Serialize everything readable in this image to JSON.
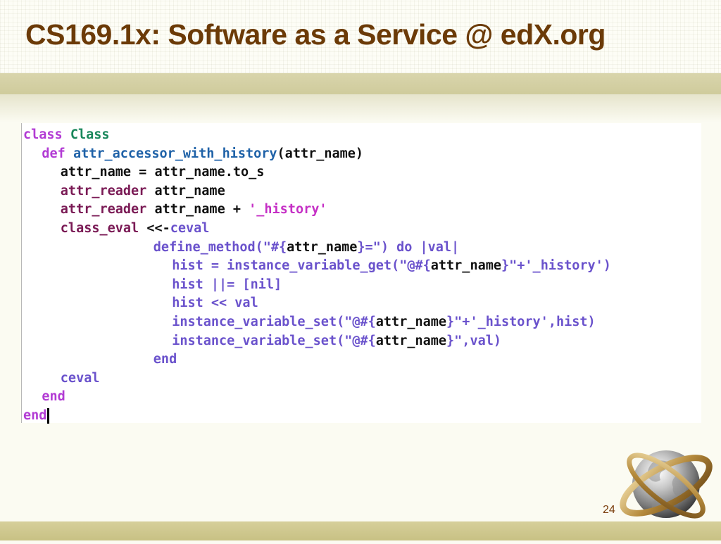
{
  "slide": {
    "title": "CS169.1x: Software as a Service @ edX.org",
    "page_number": "24"
  },
  "code": {
    "lines": [
      {
        "indent": 0,
        "tokens": [
          {
            "t": "class",
            "c": "kw"
          },
          {
            "t": " "
          },
          {
            "t": "Class",
            "c": "cls"
          }
        ]
      },
      {
        "indent": 2,
        "tokens": [
          {
            "t": "def",
            "c": "kw"
          },
          {
            "t": " "
          },
          {
            "t": "attr_accessor_with_history",
            "c": "fn"
          },
          {
            "t": "(attr_name)"
          }
        ]
      },
      {
        "indent": 4,
        "tokens": [
          {
            "t": "attr_name = attr_name.to_s"
          }
        ]
      },
      {
        "indent": 4,
        "tokens": [
          {
            "t": "attr_reader",
            "c": "sym"
          },
          {
            "t": " attr_name"
          }
        ]
      },
      {
        "indent": 4,
        "tokens": [
          {
            "t": "attr_reader",
            "c": "sym"
          },
          {
            "t": " attr_name + "
          },
          {
            "t": "'_history'",
            "c": "str"
          }
        ]
      },
      {
        "indent": 4,
        "tokens": [
          {
            "t": "class_eval",
            "c": "sym"
          },
          {
            "t": " <<-"
          },
          {
            "t": "ceval",
            "c": "heredoc"
          }
        ]
      },
      {
        "indent": 14,
        "tokens": [
          {
            "t": "define_method(\"#{",
            "c": "heredoc"
          },
          {
            "t": "attr_name",
            "c": "interp"
          },
          {
            "t": "}=\") do |val|",
            "c": "heredoc"
          }
        ]
      },
      {
        "indent": 16,
        "tokens": [
          {
            "t": "hist = instance_variable_get(\"@#{",
            "c": "heredoc"
          },
          {
            "t": "attr_name",
            "c": "interp"
          },
          {
            "t": "}\"+'_history')",
            "c": "heredoc"
          }
        ]
      },
      {
        "indent": 16,
        "tokens": [
          {
            "t": "hist ||= [nil]",
            "c": "heredoc"
          }
        ]
      },
      {
        "indent": 16,
        "tokens": [
          {
            "t": "hist << val",
            "c": "heredoc"
          }
        ]
      },
      {
        "indent": 16,
        "tokens": [
          {
            "t": "instance_variable_set(\"@#{",
            "c": "heredoc"
          },
          {
            "t": "attr_name",
            "c": "interp"
          },
          {
            "t": "}\"+'_history',hist)",
            "c": "heredoc"
          }
        ]
      },
      {
        "indent": 16,
        "tokens": [
          {
            "t": "instance_variable_set(\"@#{",
            "c": "heredoc"
          },
          {
            "t": "attr_name",
            "c": "interp"
          },
          {
            "t": "}\",val)",
            "c": "heredoc"
          }
        ]
      },
      {
        "indent": 14,
        "tokens": [
          {
            "t": "end",
            "c": "heredoc"
          }
        ]
      },
      {
        "indent": 4,
        "tokens": [
          {
            "t": "ceval",
            "c": "heredoc"
          }
        ]
      },
      {
        "indent": 2,
        "tokens": [
          {
            "t": "end",
            "c": "kw"
          }
        ]
      },
      {
        "indent": 0,
        "tokens": [
          {
            "t": "end",
            "c": "kw"
          }
        ],
        "cursor": true
      }
    ]
  },
  "colors": {
    "title": "#6b3a07",
    "keyword": "#b23bd4",
    "class_name": "#19875b",
    "method_name": "#1f62a8",
    "heredoc": "#6a52cc",
    "string": "#c52fc5",
    "symbol": "#7a1a55",
    "band": "#d9d5ac",
    "footer": "#c8c184"
  },
  "icons": {
    "logo": "globe-icon"
  }
}
